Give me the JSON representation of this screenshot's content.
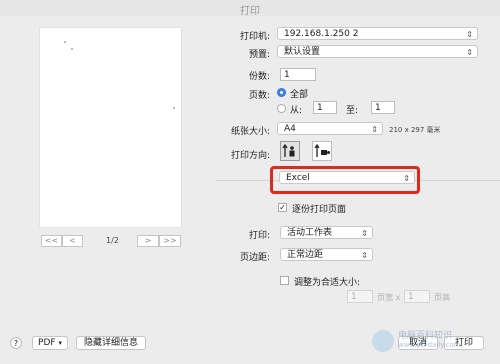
{
  "window": {
    "title": "打印"
  },
  "preview": {
    "page_indicator": "1/2",
    "nav": {
      "first": "<<",
      "prev": "<",
      "next": ">",
      "last": ">>"
    }
  },
  "printer": {
    "label": "打印机:",
    "value": "192.168.1.250 2"
  },
  "presets": {
    "label": "预置:",
    "value": "默认设置"
  },
  "copies": {
    "label": "份数:",
    "value": "1"
  },
  "pages": {
    "label": "页数:",
    "all_label": "全部",
    "from_label": "从:",
    "from_value": "1",
    "to_label": "至:",
    "to_value": "1",
    "selected": "all"
  },
  "paper_size": {
    "label": "纸张大小:",
    "value": "A4",
    "dimensions": "210 x 297 毫米"
  },
  "orientation": {
    "label": "打印方向:",
    "selected": "portrait"
  },
  "app_section": {
    "value": "Excel"
  },
  "collate": {
    "label": "逐份打印页面",
    "checked": true
  },
  "print_what": {
    "label": "打印:",
    "value": "活动工作表"
  },
  "margins": {
    "label": "页边距:",
    "value": "正常边距"
  },
  "scale": {
    "label": "调整为合适大小:",
    "checked": false,
    "width_value": "1",
    "mid_label": "页宽 x",
    "height_value": "1",
    "tail_label": "页高"
  },
  "bottom": {
    "help": "?",
    "pdf": "PDF",
    "hide_details": "隐藏详细信息",
    "cancel": "取消",
    "print": "打印"
  },
  "watermark": {
    "text": "电脑百科知识",
    "sub": "www.pc-daily.com"
  }
}
